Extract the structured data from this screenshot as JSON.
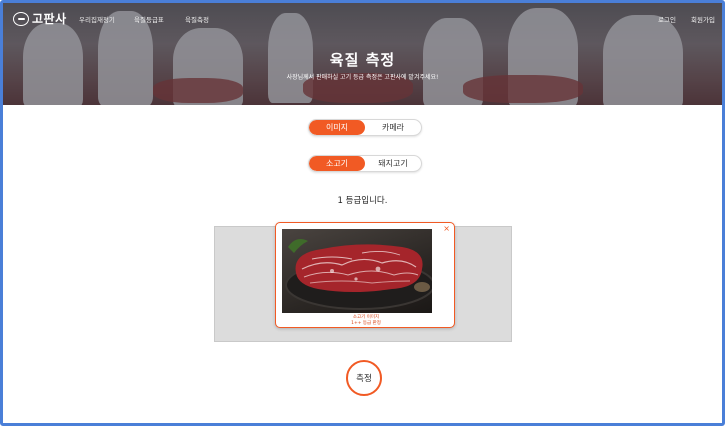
{
  "brand": {
    "name": "고판사"
  },
  "nav": {
    "links": [
      "우리집재정기",
      "육질등급표",
      "육질측정"
    ],
    "login": "로그인",
    "signup": "회원가입"
  },
  "hero": {
    "title": "육질 측정",
    "subtitle": "사장님께서 판매하실 고기 등급 측정은 고판사에 맡겨주세요!"
  },
  "source_toggle": {
    "options": [
      "이미지",
      "카메라"
    ],
    "selected": "이미지"
  },
  "meat_toggle": {
    "options": [
      "소고기",
      "돼지고기"
    ],
    "selected": "소고기"
  },
  "result": {
    "grade_text": "1 등급입니다."
  },
  "upload": {
    "close": "×",
    "caption_line1": "소고기 이미지",
    "caption_line2": "1++ 등급 판정"
  },
  "measure_button": {
    "label": "측정"
  },
  "colors": {
    "accent": "#f15a24",
    "frame": "#4a7fd8",
    "dropzone": "#dcdcdc"
  }
}
